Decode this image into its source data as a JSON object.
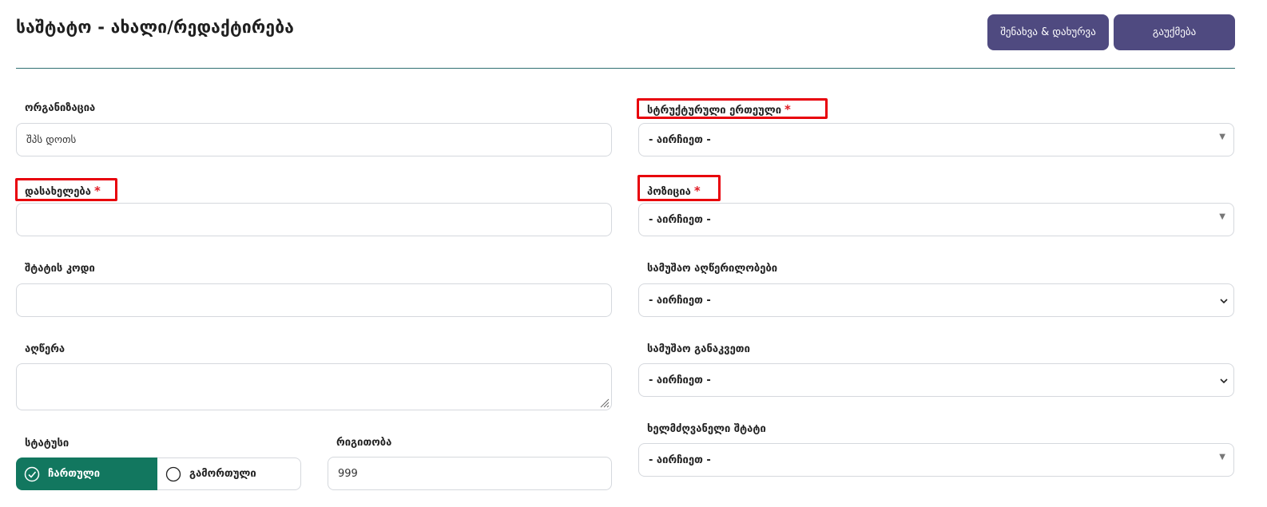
{
  "header": {
    "title": "საშტატო - ახალი/რედაქტირება",
    "save_close_label": "შენახვა & დახურვა",
    "cancel_label": "გაუქმება"
  },
  "form": {
    "organization": {
      "label": "ორგანიზაცია",
      "value": "შპს დოთს"
    },
    "name": {
      "label": "დასახელება",
      "required_mark": "*",
      "value": ""
    },
    "staff_code": {
      "label": "შტატის კოდი",
      "value": ""
    },
    "description": {
      "label": "აღწერა",
      "value": ""
    },
    "status": {
      "label": "სტატუსი",
      "option_on": "ჩართული",
      "option_off": "გამორთული",
      "selected": "ჩართული"
    },
    "order": {
      "label": "რიგითობა",
      "value": "999"
    },
    "structural_unit": {
      "label": "სტრუქტურული ერთეული",
      "required_mark": "*",
      "value": "- აირჩიეთ -"
    },
    "position": {
      "label": "პოზიცია",
      "required_mark": "*",
      "value": "- აირჩიეთ -"
    },
    "work_descriptions": {
      "label": "სამუშაო აღწერილობები",
      "value": "- აირჩიეთ -"
    },
    "work_schedule": {
      "label": "სამუშაო განაკვეთი",
      "value": "- აირჩიეთ -"
    },
    "manager_staff": {
      "label": "ხელმძღვანელი შტატი",
      "value": "- აირჩიეთ -"
    }
  },
  "colors": {
    "primary_button": "#4f4a80",
    "status_on": "#12775f",
    "required": "#e01b24",
    "highlight": "#e8000b"
  }
}
